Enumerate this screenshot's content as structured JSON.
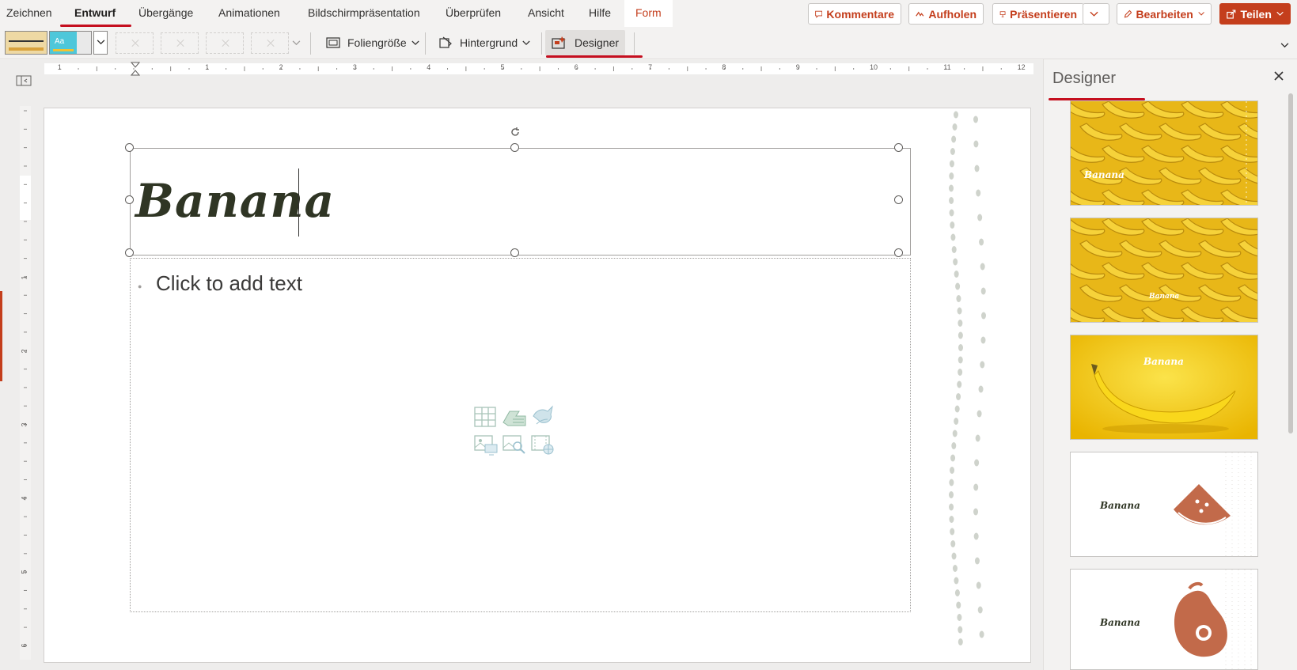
{
  "tabs": [
    {
      "label": "Zeichnen"
    },
    {
      "label": "Entwurf"
    },
    {
      "label": "Übergänge"
    },
    {
      "label": "Animationen"
    },
    {
      "label": "Bildschirmpräsentation"
    },
    {
      "label": "Überprüfen"
    },
    {
      "label": "Ansicht"
    },
    {
      "label": "Hilfe"
    },
    {
      "label": "Form"
    }
  ],
  "actions": {
    "comments": "Kommentare",
    "catchup": "Aufholen",
    "present": "Präsentieren",
    "edit": "Bearbeiten",
    "share": "Teilen"
  },
  "toolbar": {
    "slide_size": "Foliengröße",
    "background": "Hintergrund",
    "designer": "Designer"
  },
  "slide": {
    "title": "Banana",
    "body_placeholder": "Click to add text"
  },
  "designer_pane": {
    "title": "Designer",
    "thumbnails": [
      {
        "label": "Banana"
      },
      {
        "label": "Banana"
      },
      {
        "label": "Banana"
      },
      {
        "label": "Banana"
      },
      {
        "label": "Banana"
      }
    ]
  },
  "ruler": {
    "h_ticks": [
      "1",
      "1",
      "2",
      "3",
      "4",
      "5",
      "6",
      "7",
      "8",
      "9",
      "10",
      "11",
      "12"
    ],
    "v_ticks": [
      "1",
      "2",
      "3",
      "4",
      "5",
      "6"
    ]
  },
  "colors": {
    "accent": "#c43e1c",
    "tab_underline": "#c50f1f",
    "title_text": "#2f3524",
    "banana_yellow": "#f2c21b",
    "terracotta": "#c26a4a"
  }
}
